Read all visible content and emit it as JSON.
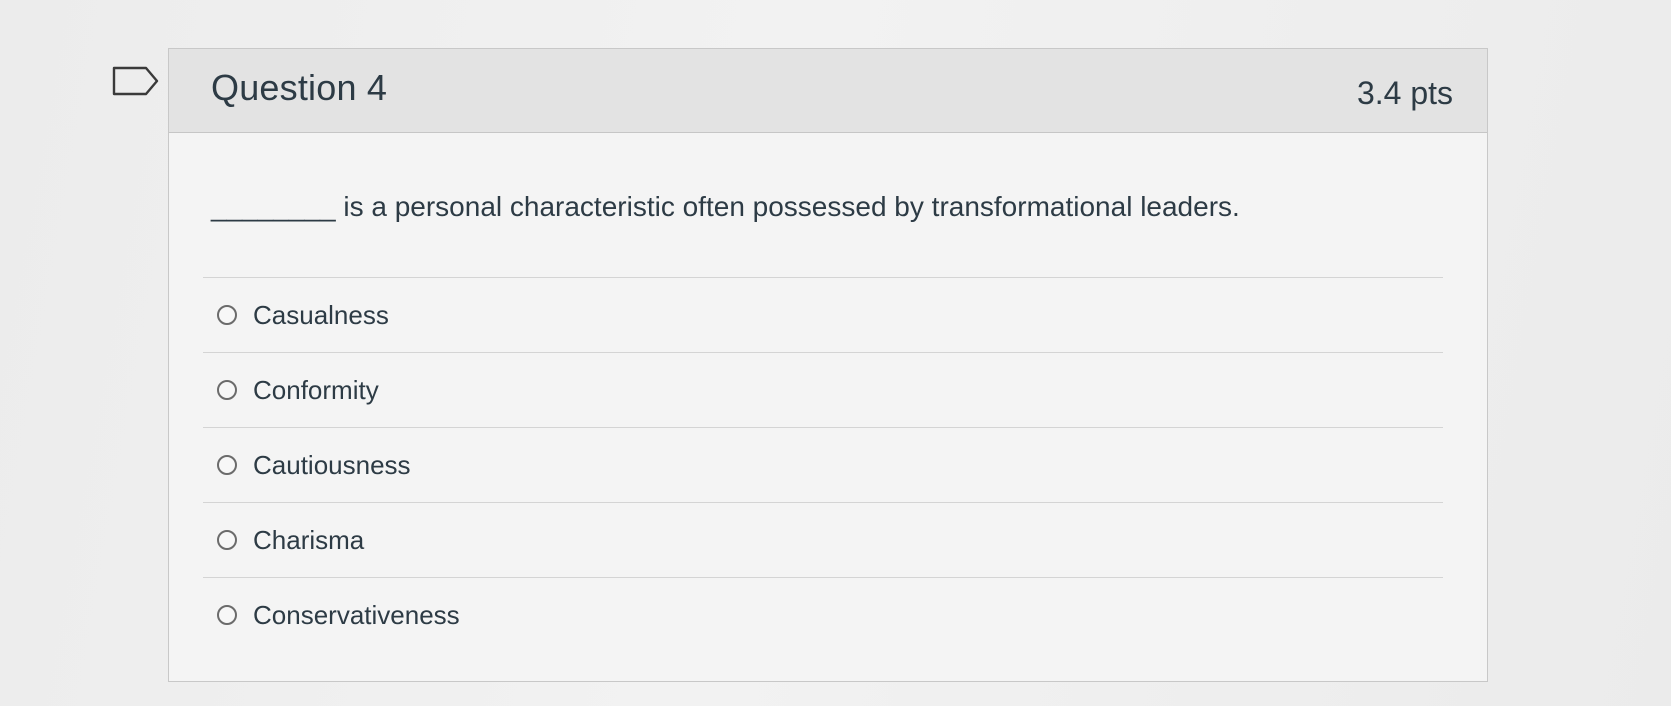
{
  "question": {
    "title": "Question 4",
    "points": "3.4 pts",
    "text": "________ is a personal characteristic often possessed by transformational leaders.",
    "flag_icon": "flag-outline-icon"
  },
  "answers": [
    {
      "label": "Casualness",
      "selected": false
    },
    {
      "label": "Conformity",
      "selected": false
    },
    {
      "label": "Cautiousness",
      "selected": false
    },
    {
      "label": "Charisma",
      "selected": false
    },
    {
      "label": "Conservativeness",
      "selected": false
    }
  ],
  "colors": {
    "text": "#2d3b45",
    "header_bg": "#e3e3e3",
    "card_bg": "#f4f4f4",
    "border": "#c8c8c8"
  }
}
